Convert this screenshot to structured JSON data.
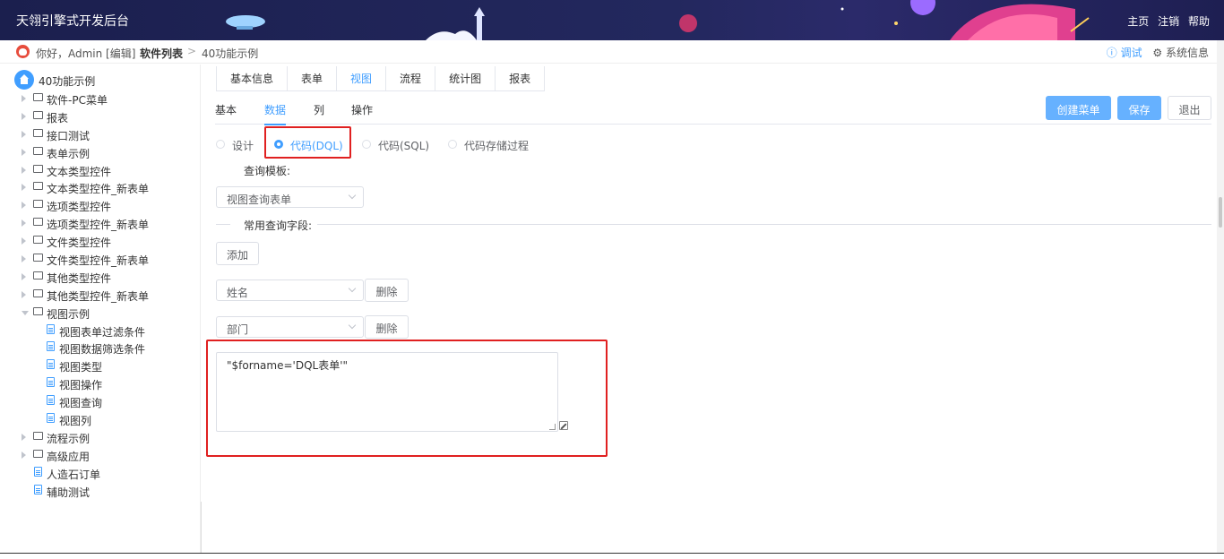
{
  "header": {
    "title": "天翎引擎式开发后台",
    "links": [
      "主页",
      "注销",
      "帮助"
    ]
  },
  "breadcrumb": {
    "greeting": "你好，Admin [编辑]",
    "level1": "软件列表",
    "separator": ">",
    "level2": "40功能示例",
    "debug": "ⓘ 调试",
    "sysinfo": "⚙ 系统信息"
  },
  "sidebar": {
    "root": "40功能示例",
    "nodes": [
      {
        "label": "软件-PC菜单",
        "type": "folder",
        "level": 0,
        "state": "collapsed"
      },
      {
        "label": "报表",
        "type": "folder",
        "level": 0,
        "state": "collapsed"
      },
      {
        "label": "接口测试",
        "type": "folder",
        "level": 0,
        "state": "collapsed"
      },
      {
        "label": "表单示例",
        "type": "folder",
        "level": 0,
        "state": "collapsed"
      },
      {
        "label": "文本类型控件",
        "type": "folder",
        "level": 0,
        "state": "collapsed"
      },
      {
        "label": "文本类型控件_新表单",
        "type": "folder",
        "level": 0,
        "state": "collapsed"
      },
      {
        "label": "选项类型控件",
        "type": "folder",
        "level": 0,
        "state": "collapsed"
      },
      {
        "label": "选项类型控件_新表单",
        "type": "folder",
        "level": 0,
        "state": "collapsed"
      },
      {
        "label": "文件类型控件",
        "type": "folder",
        "level": 0,
        "state": "collapsed"
      },
      {
        "label": "文件类型控件_新表单",
        "type": "folder",
        "level": 0,
        "state": "collapsed"
      },
      {
        "label": "其他类型控件",
        "type": "folder",
        "level": 0,
        "state": "collapsed"
      },
      {
        "label": "其他类型控件_新表单",
        "type": "folder",
        "level": 0,
        "state": "collapsed"
      },
      {
        "label": "视图示例",
        "type": "folder",
        "level": 0,
        "state": "expanded"
      },
      {
        "label": "视图表单过滤条件",
        "type": "file",
        "level": 1,
        "state": "leaf"
      },
      {
        "label": "视图数据筛选条件",
        "type": "file",
        "level": 1,
        "state": "leaf"
      },
      {
        "label": "视图类型",
        "type": "file",
        "level": 1,
        "state": "leaf"
      },
      {
        "label": "视图操作",
        "type": "file",
        "level": 1,
        "state": "leaf"
      },
      {
        "label": "视图查询",
        "type": "file",
        "level": 1,
        "state": "leaf"
      },
      {
        "label": "视图列",
        "type": "file",
        "level": 1,
        "state": "leaf"
      },
      {
        "label": "流程示例",
        "type": "folder",
        "level": 0,
        "state": "collapsed"
      },
      {
        "label": "高级应用",
        "type": "folder",
        "level": 0,
        "state": "collapsed"
      },
      {
        "label": "人造石订单",
        "type": "file",
        "level": 0,
        "state": "leaf"
      },
      {
        "label": "辅助测试",
        "type": "file",
        "level": 0,
        "state": "leaf"
      }
    ]
  },
  "tabs": [
    {
      "label": "基本信息",
      "active": false
    },
    {
      "label": "表单",
      "active": false
    },
    {
      "label": "视图",
      "active": true
    },
    {
      "label": "流程",
      "active": false
    },
    {
      "label": "统计图",
      "active": false
    },
    {
      "label": "报表",
      "active": false
    }
  ],
  "subtabs": [
    {
      "label": "基本",
      "active": false
    },
    {
      "label": "数据",
      "active": true
    },
    {
      "label": "列",
      "active": false
    },
    {
      "label": "操作",
      "active": false
    }
  ],
  "actions": {
    "create_menu": "创建菜单",
    "save": "保存",
    "exit": "退出"
  },
  "modes": [
    {
      "label": "设计",
      "checked": false
    },
    {
      "label": "代码(DQL)",
      "checked": true
    },
    {
      "label": "代码(SQL)",
      "checked": false
    },
    {
      "label": "代码存储过程",
      "checked": false
    }
  ],
  "query": {
    "template_label": "查询模板:",
    "template_value": "视图查询表单",
    "fields_label": "常用查询字段:",
    "add_button": "添加",
    "fields": [
      {
        "value": "姓名",
        "delete_label": "删除"
      },
      {
        "value": "部门",
        "delete_label": "删除"
      }
    ],
    "code": "\"$forname='DQL表单'\""
  },
  "colors": {
    "accent": "#409eff",
    "highlight": "#e02020",
    "header_bg": "#1b1f4e"
  }
}
